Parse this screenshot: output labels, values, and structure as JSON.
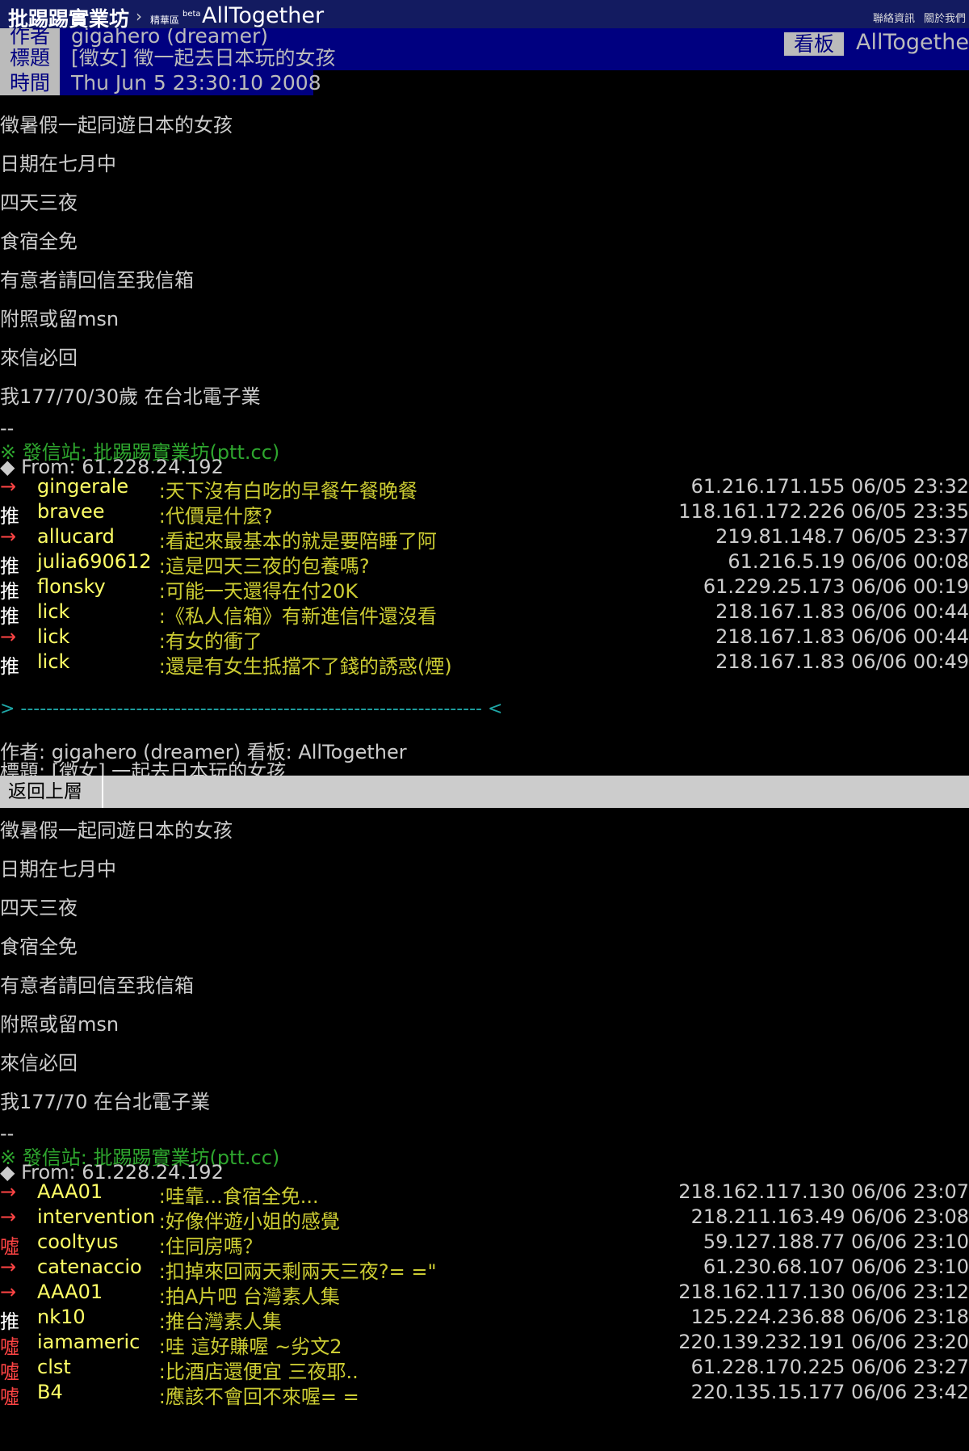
{
  "topbar": {
    "site": "批踢踢實業坊",
    "separator": "›",
    "section": "精華區",
    "beta": "beta",
    "board": "AllTogether",
    "links": [
      "聯絡資訊",
      "關於我們"
    ]
  },
  "meta": {
    "author_label": "作者",
    "author": "gigahero (dreamer)",
    "title_label": "標題",
    "title": "[徵女] 徵一起去日本玩的女孩",
    "time_label": "時間",
    "time": "Thu Jun  5 23:30:10 2008",
    "board_label": "看板",
    "board": "AllTogether"
  },
  "post1": {
    "body": [
      "徵暑假一起同遊日本的女孩",
      "日期在七月中",
      "四天三夜",
      "食宿全免",
      "有意者請回信至我信箱",
      "附照或留msn",
      "來信必回",
      "我177/70/30歲 在台北電子業"
    ],
    "dashes": "--",
    "sig": "※ 發信站: 批踢踢實業坊(ptt.cc)",
    "from": "◆ From: 61.228.24.192",
    "pushes": [
      {
        "tag": "→",
        "user": "gingerale",
        "content": ":天下沒有白吃的早餐午餐晚餐",
        "ip": "61.216.171.155 06/05 23:32"
      },
      {
        "tag": "推",
        "user": "bravee",
        "content": ":代價是什麼?",
        "ip": "118.161.172.226 06/05 23:35"
      },
      {
        "tag": "→",
        "user": "allucard",
        "content": ":看起來最基本的就是要陪睡了阿",
        "ip": "219.81.148.7 06/05 23:37"
      },
      {
        "tag": "推",
        "user": "julia690612",
        "content": ":這是四天三夜的包養嗎?",
        "ip": "61.216.5.19 06/06 00:08"
      },
      {
        "tag": "推",
        "user": "flonsky",
        "content": ":可能一天還得在付20K",
        "ip": "61.229.25.173 06/06 00:19"
      },
      {
        "tag": "推",
        "user": "lick",
        "content": ":《私人信箱》有新進信件還沒看",
        "ip": "218.167.1.83 06/06 00:44"
      },
      {
        "tag": "→",
        "user": "lick",
        "content": ":有女的衝了",
        "ip": "218.167.1.83 06/06 00:44"
      },
      {
        "tag": "推",
        "user": "lick",
        "content": ":還是有女生抵擋不了錢的誘惑(煙)",
        "ip": "218.167.1.83 06/06 00:49"
      }
    ]
  },
  "separator_line": "> ------------------------------------------------------------------------ <",
  "quote_header": {
    "author_line": "作者: gigahero (dreamer) 看板: AllTogether",
    "title_line": "標題: [徵女] 一起去日本玩的女孩"
  },
  "back_button": "返回上層",
  "post2": {
    "body": [
      "徵暑假一起同遊日本的女孩",
      "日期在七月中",
      "四天三夜",
      "食宿全免",
      "有意者請回信至我信箱",
      "附照或留msn",
      "來信必回",
      "我177/70 在台北電子業"
    ],
    "dashes": "--",
    "sig": "※ 發信站: 批踢踢實業坊(ptt.cc)",
    "from": "◆ From: 61.228.24.192",
    "pushes": [
      {
        "tag": "→",
        "user": "AAA01",
        "content": ":哇靠...食宿全免...",
        "ip": "218.162.117.130 06/06 23:07"
      },
      {
        "tag": "→",
        "user": "intervention",
        "content": ":好像伴遊小姐的感覺",
        "ip": "218.211.163.49 06/06 23:08"
      },
      {
        "tag": "噓",
        "user": "cooltyus",
        "content": ":住同房嗎？",
        "ip": "59.127.188.77 06/06 23:10"
      },
      {
        "tag": "→",
        "user": "catenaccio",
        "content": ":扣掉來回兩天剩兩天三夜?= =\"",
        "ip": "61.230.68.107 06/06 23:10"
      },
      {
        "tag": "→",
        "user": "AAA01",
        "content": ":拍A片吧   台灣素人集",
        "ip": "218.162.117.130 06/06 23:12"
      },
      {
        "tag": "推",
        "user": "nk10",
        "content": ":推台灣素人集",
        "ip": "125.224.236.88 06/06 23:18"
      },
      {
        "tag": "噓",
        "user": "iamameric",
        "content": ":哇 這好賺喔 ~劣文2",
        "ip": "220.139.232.191 06/06 23:20"
      },
      {
        "tag": "噓",
        "user": "clst",
        "content": ":比酒店還便宜 三夜耶..",
        "ip": "61.228.170.225 06/06 23:27"
      },
      {
        "tag": "噓",
        "user": "B4",
        "content": ":應該不會回不來喔= =",
        "ip": "220.135.15.177 06/06 23:42"
      }
    ]
  }
}
